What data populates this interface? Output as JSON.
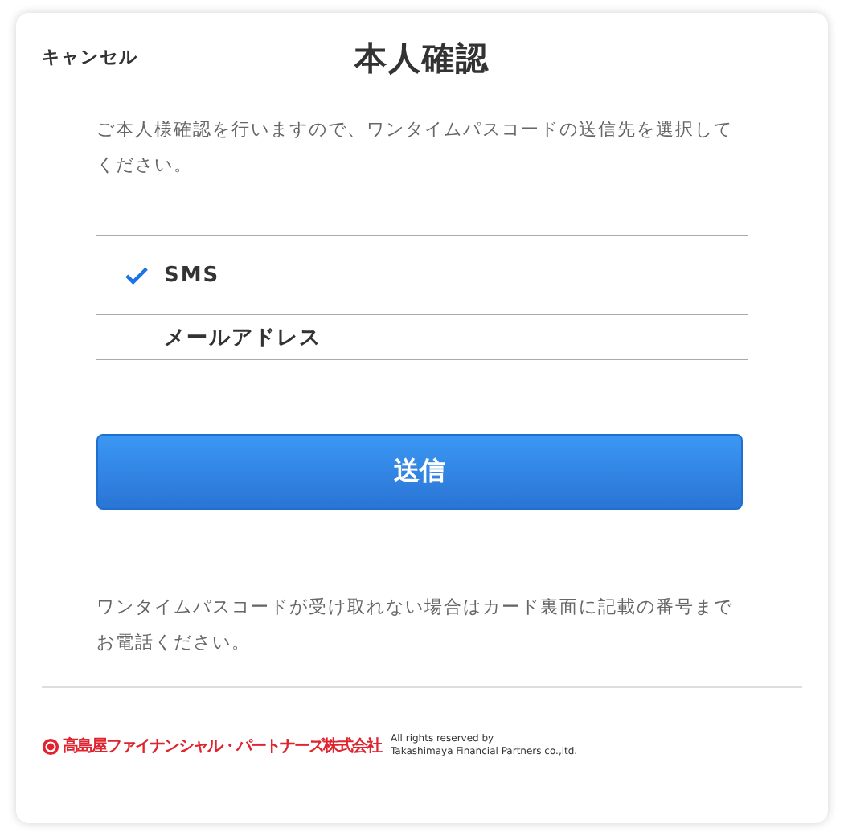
{
  "header": {
    "cancel": "キャンセル",
    "title": "本人確認"
  },
  "instruction": "ご本人様確認を行いますので、ワンタイムパスコードの送信先を選択してください。",
  "options": [
    {
      "label": "SMS",
      "selected": true
    },
    {
      "label": "メールアドレス",
      "selected": false
    }
  ],
  "submit_button": "送信",
  "note": "ワンタイムパスコードが受け取れない場合はカード裏面に記載の番号までお電話ください。",
  "footer": {
    "company": "高島屋ファイナンシャル・パートナーズ株式会社",
    "copyright": [
      "All rights reserved by",
      "Takashimaya Financial Partners co.,ltd."
    ]
  }
}
